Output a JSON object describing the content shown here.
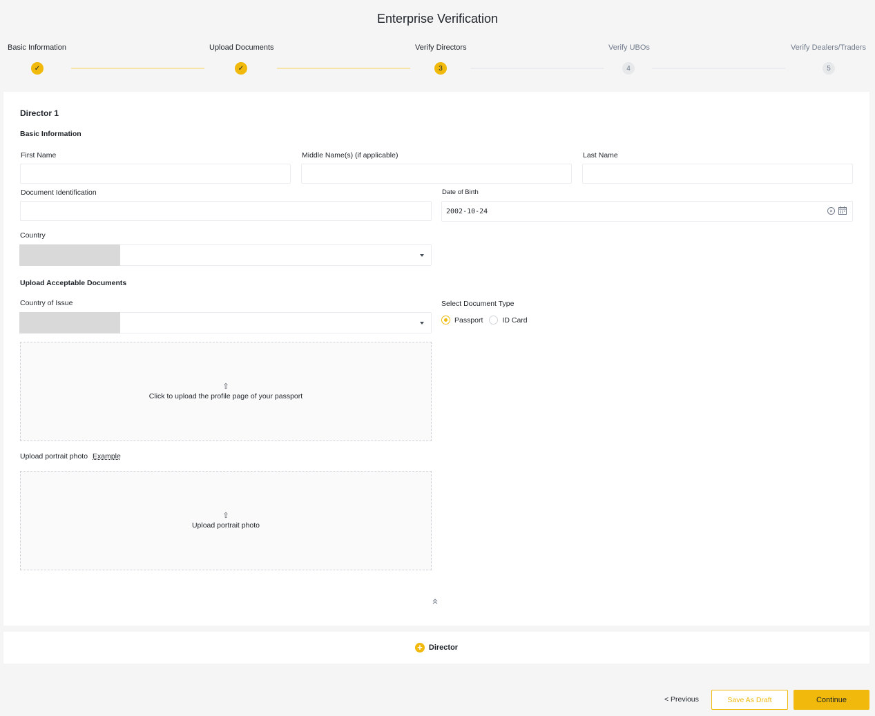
{
  "page": {
    "title": "Enterprise Verification"
  },
  "steps": [
    {
      "label": "Basic Information",
      "status": "done",
      "marker": "✓"
    },
    {
      "label": "Upload Documents",
      "status": "done",
      "marker": "✓"
    },
    {
      "label": "Verify Directors",
      "status": "current",
      "marker": "3"
    },
    {
      "label": "Verify UBOs",
      "status": "todo",
      "marker": "4"
    },
    {
      "label": "Verify Dealers/Traders",
      "status": "todo",
      "marker": "5"
    }
  ],
  "director": {
    "title": "Director 1",
    "basic_info_title": "Basic Information",
    "first_name_label": "First Name",
    "first_name_value": "",
    "middle_name_label": "Middle Name(s) (if applicable)",
    "middle_name_value": "",
    "last_name_label": "Last Name",
    "last_name_value": "",
    "document_id_label": "Document Identification",
    "document_id_value": "",
    "dob_label": "Date of Birth",
    "dob_value": "2002-10-24",
    "country_label": "Country",
    "country_value": ""
  },
  "documents": {
    "title": "Upload Acceptable Documents",
    "country_of_issue_label": "Country of Issue",
    "country_of_issue_value": "",
    "doc_type_label": "Select Document Type",
    "doc_type_options": [
      "Passport",
      "ID Card"
    ],
    "doc_type_selected": "Passport",
    "passport_upload_text": "Click to upload the profile page of your passport",
    "portrait_label": "Upload portrait photo",
    "portrait_example": "Example",
    "portrait_upload_text": "Upload portrait photo"
  },
  "add_director_label": "Director",
  "footer": {
    "previous": "< Previous",
    "save_draft": "Save As Draft",
    "continue": "Continue"
  },
  "colors": {
    "accent": "#f0b90b",
    "text": "#1e2329",
    "muted": "#707a8a",
    "border": "#eaecef"
  },
  "icons": [
    "check-icon",
    "calendar-icon",
    "clear-icon",
    "chevron-down-icon",
    "upload-icon",
    "chevrons-up-icon",
    "plus-circle-icon"
  ]
}
